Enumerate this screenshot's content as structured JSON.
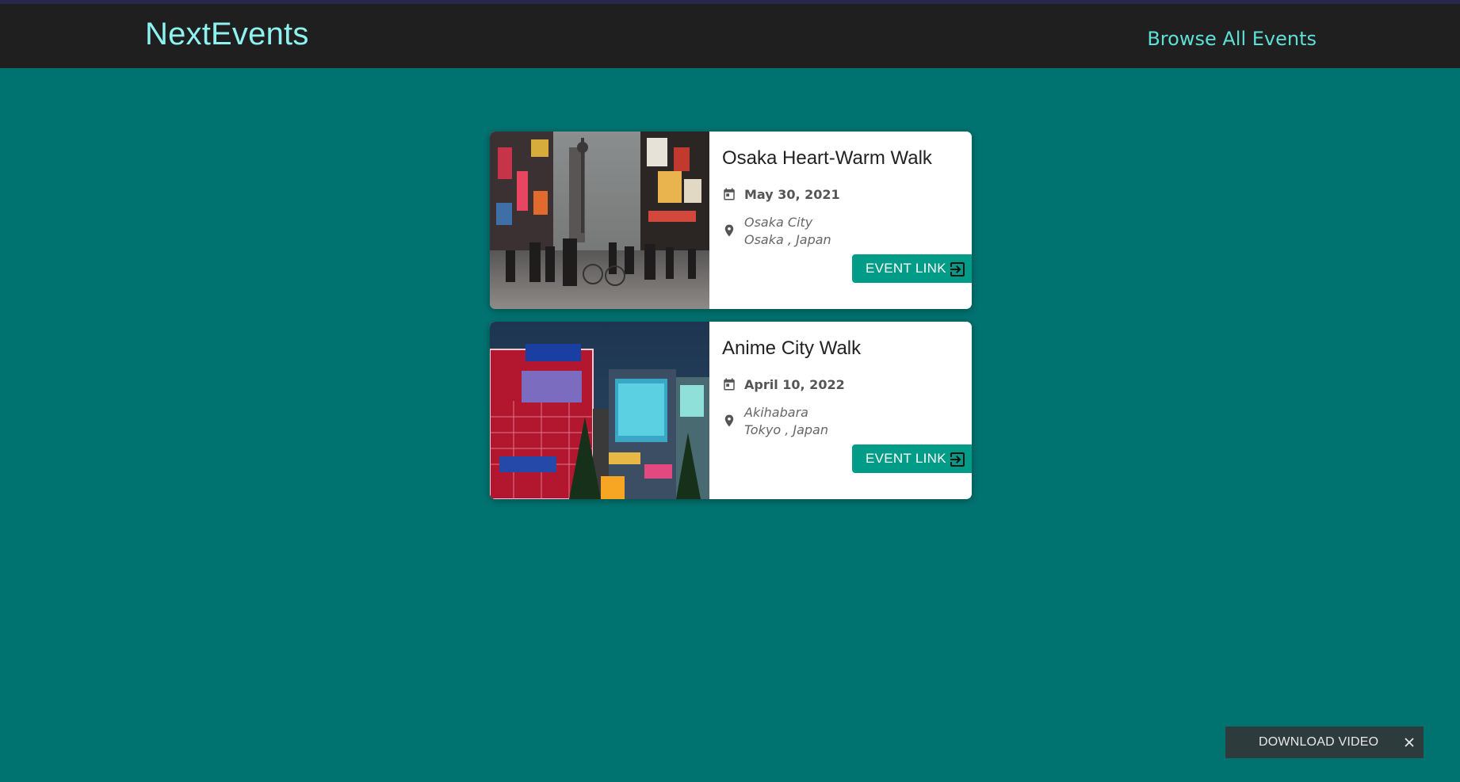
{
  "app": {
    "logo": "NextEvents",
    "nav_link": "Browse All Events"
  },
  "colors": {
    "background": "#007371",
    "header": "#1f1f1f",
    "logo": "#8ef3f0",
    "accent_button": "#009c87"
  },
  "events": [
    {
      "title": "Osaka Heart-Warm Walk",
      "date": "May 30, 2021",
      "address_line1": "Osaka City",
      "address_line2": "Osaka , Japan",
      "button_label": "EVENT LINK",
      "image": "osaka-street-photo"
    },
    {
      "title": "Anime City Walk",
      "date": "April 10, 2022",
      "address_line1": "Akihabara",
      "address_line2": "Tokyo , Japan",
      "button_label": "EVENT LINK",
      "image": "akihabara-night-photo"
    }
  ],
  "icons": {
    "date": "calendar-icon",
    "address": "map-pin-icon",
    "button": "arrow-right-box-icon",
    "close": "close-icon"
  },
  "download_bar": {
    "label": "DOWNLOAD VIDEO"
  }
}
